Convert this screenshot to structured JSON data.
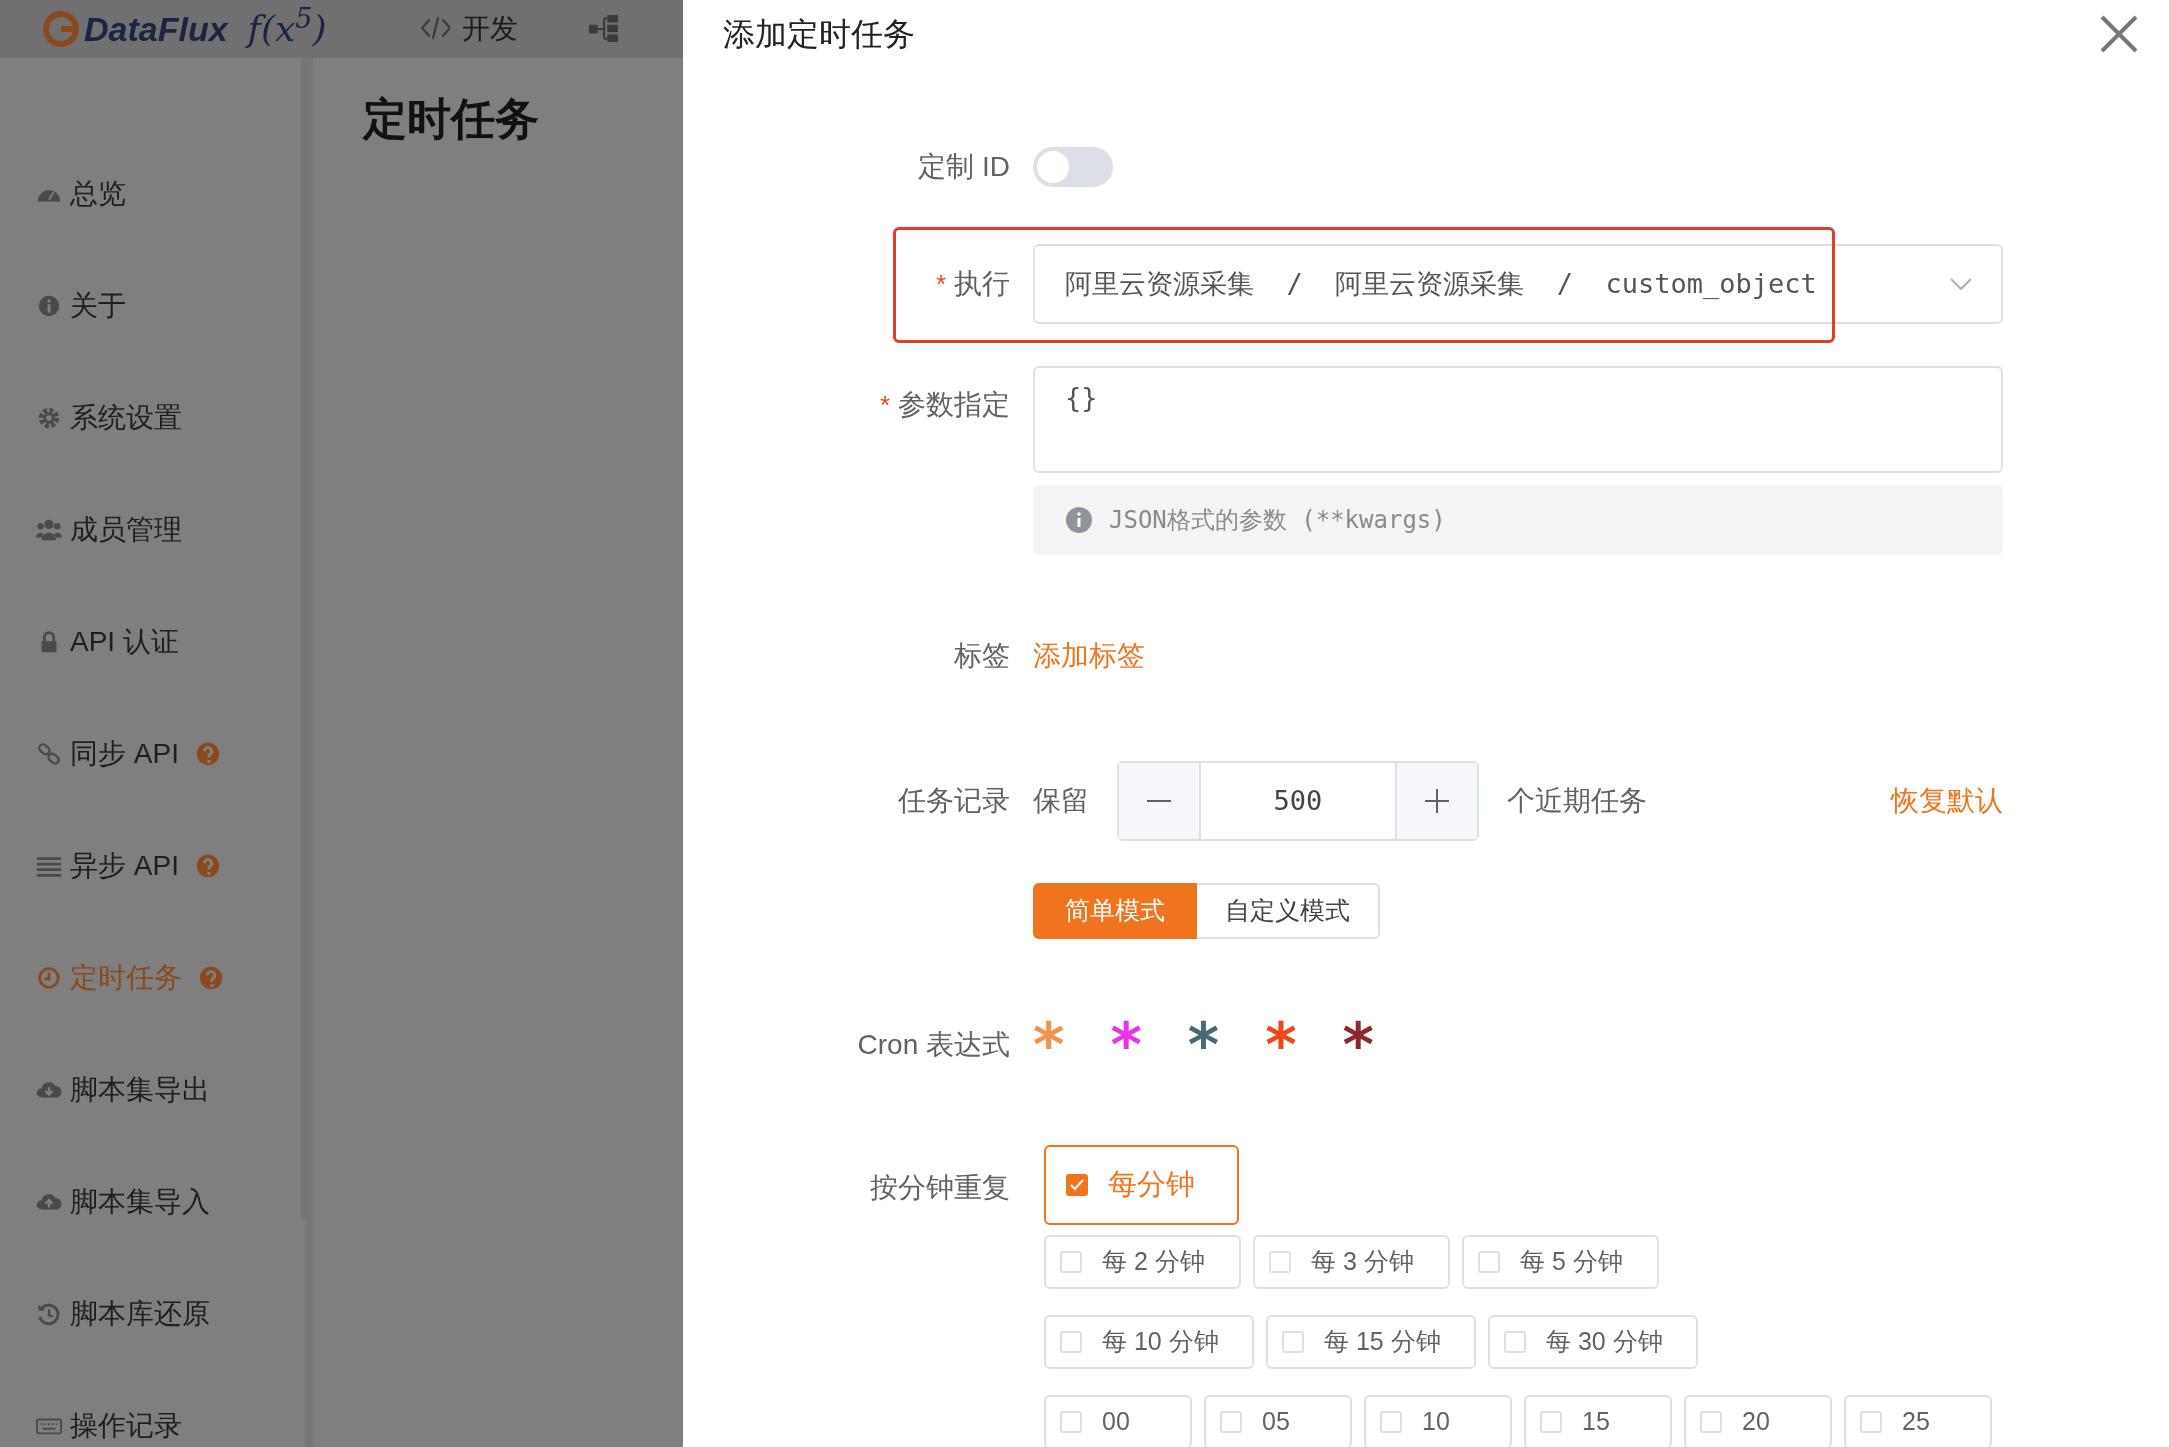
{
  "header": {
    "logo_text": "DataFlux",
    "logo_formula": "f(x$^{5}$)",
    "nav": [
      {
        "label": "开发"
      },
      {
        "kind": "icon"
      }
    ]
  },
  "sidebar": {
    "items": [
      {
        "label": "总览",
        "help": false,
        "selected": false
      },
      {
        "label": "关于",
        "help": false,
        "selected": false
      },
      {
        "label": "系统设置",
        "help": false,
        "selected": false
      },
      {
        "label": "成员管理",
        "help": false,
        "selected": false
      },
      {
        "label": "API 认证",
        "help": false,
        "selected": false
      },
      {
        "label": "同步 API",
        "help": true,
        "selected": false
      },
      {
        "label": "异步 API",
        "help": true,
        "selected": false
      },
      {
        "label": "定时任务",
        "help": true,
        "selected": true
      },
      {
        "label": "脚本集导出",
        "help": false,
        "selected": false
      },
      {
        "label": "脚本集导入",
        "help": false,
        "selected": false
      },
      {
        "label": "脚本库还原",
        "help": false,
        "selected": false
      },
      {
        "label": "操作记录",
        "help": false,
        "selected": false
      }
    ]
  },
  "page_title": "定时任务",
  "drawer": {
    "title": "添加定时任务",
    "custom_id": {
      "label": "定制 ID",
      "on": false
    },
    "execute": {
      "label": "执行",
      "required": true,
      "highlighted": true,
      "value": "阿里云资源采集  /  阿里云资源采集  /  custom_object"
    },
    "params": {
      "label": "参数指定",
      "required": true,
      "value": "{}",
      "hint": "JSON格式的参数 (**kwargs)"
    },
    "tags": {
      "label": "标签",
      "add_link": "添加标签"
    },
    "task_record": {
      "label": "任务记录",
      "prefix": "保留",
      "value": "500",
      "suffix": "个近期任务",
      "reset": "恢复默认"
    },
    "modes": [
      {
        "label": "简单模式",
        "selected": true
      },
      {
        "label": "自定义模式",
        "selected": false
      }
    ],
    "cron": {
      "label": "Cron 表达式",
      "parts": [
        {
          "text": "*",
          "color": "#f0944d"
        },
        {
          "text": "*",
          "color": "#e535e5"
        },
        {
          "text": "*",
          "color": "#4a6a73"
        },
        {
          "text": "*",
          "color": "#f0461e"
        },
        {
          "text": "*",
          "color": "#8b2a2a"
        }
      ]
    },
    "minute_repeat": {
      "label": "按分钟重复",
      "rows": [
        [
          {
            "label": "每分钟",
            "checked": true
          }
        ],
        [
          {
            "label": "每 2 分钟",
            "checked": false
          },
          {
            "label": "每 3 分钟",
            "checked": false
          },
          {
            "label": "每 5 分钟",
            "checked": false
          }
        ],
        [
          {
            "label": "每 10 分钟",
            "checked": false
          },
          {
            "label": "每 15 分钟",
            "checked": false
          },
          {
            "label": "每 30 分钟",
            "checked": false
          }
        ],
        [
          {
            "label": "00",
            "checked": false
          },
          {
            "label": "05",
            "checked": false
          },
          {
            "label": "10",
            "checked": false
          },
          {
            "label": "15",
            "checked": false
          },
          {
            "label": "20",
            "checked": false
          },
          {
            "label": "25",
            "checked": false
          }
        ]
      ]
    }
  }
}
